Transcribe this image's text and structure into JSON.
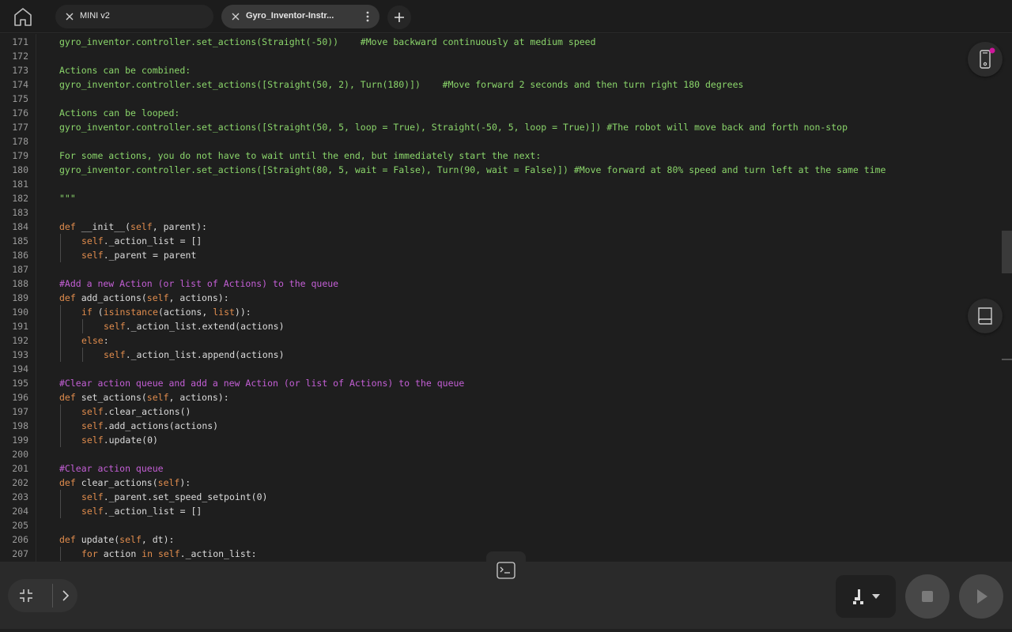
{
  "tabs": [
    {
      "label": "MINI v2",
      "active": false
    },
    {
      "label": "Gyro_Inventor-Instr...",
      "active": true
    }
  ],
  "icons": {
    "home": "home-icon",
    "close": "close-icon",
    "menu": "more-vertical-icon",
    "add": "plus-icon",
    "device": "robot-device-icon",
    "docs": "book-icon",
    "terminal": "terminal-icon",
    "collapse": "collapse-icon",
    "expand": "chevron-right-icon",
    "robot": "robot-select-icon",
    "dropdown": "caret-down-icon",
    "stop": "stop-icon",
    "run": "play-icon"
  },
  "colors": {
    "docstring": "#8bd66b",
    "comment": "#c45fd6",
    "keyword": "#e08c4d",
    "text": "#dcdcdc",
    "badge": "#d0169c"
  },
  "code_lines": [
    {
      "n": "171",
      "indent": 0,
      "parts": [
        [
          "doc",
          "gyro_inventor.controller.set_actions(Straight(-50))    #Move backward continuously at medium speed"
        ]
      ]
    },
    {
      "n": "172",
      "indent": 0,
      "parts": []
    },
    {
      "n": "173",
      "indent": 0,
      "parts": [
        [
          "doc",
          "Actions can be combined:"
        ]
      ]
    },
    {
      "n": "174",
      "indent": 0,
      "parts": [
        [
          "doc",
          "gyro_inventor.controller.set_actions([Straight(50, 2), Turn(180)])    #Move forward 2 seconds and then turn right 180 degrees"
        ]
      ]
    },
    {
      "n": "175",
      "indent": 0,
      "parts": []
    },
    {
      "n": "176",
      "indent": 0,
      "parts": [
        [
          "doc",
          "Actions can be looped:"
        ]
      ]
    },
    {
      "n": "177",
      "indent": 0,
      "parts": [
        [
          "doc",
          "gyro_inventor.controller.set_actions([Straight(50, 5, loop = True), Straight(-50, 5, loop = True)]) #The robot will move back and forth non-stop"
        ]
      ]
    },
    {
      "n": "178",
      "indent": 0,
      "parts": []
    },
    {
      "n": "179",
      "indent": 0,
      "parts": [
        [
          "doc",
          "For some actions, you do not have to wait until the end, but immediately start the next:"
        ]
      ]
    },
    {
      "n": "180",
      "indent": 0,
      "parts": [
        [
          "doc",
          "gyro_inventor.controller.set_actions([Straight(80, 5, wait = False), Turn(90, wait = False)]) #Move forward at 80% speed and turn left at the same time"
        ]
      ]
    },
    {
      "n": "181",
      "indent": 0,
      "parts": []
    },
    {
      "n": "182",
      "indent": 0,
      "parts": [
        [
          "doc",
          "\"\"\""
        ]
      ]
    },
    {
      "n": "183",
      "indent": 0,
      "parts": []
    },
    {
      "n": "184",
      "indent": 0,
      "parts": [
        [
          "kw",
          "def "
        ],
        [
          "txt",
          "__init__("
        ],
        [
          "self",
          "self"
        ],
        [
          "txt",
          ", parent):"
        ]
      ]
    },
    {
      "n": "185",
      "indent": 1,
      "parts": [
        [
          "self",
          "self"
        ],
        [
          "txt",
          "._action_list = []"
        ]
      ]
    },
    {
      "n": "186",
      "indent": 1,
      "parts": [
        [
          "self",
          "self"
        ],
        [
          "txt",
          "._parent = parent"
        ]
      ]
    },
    {
      "n": "187",
      "indent": 0,
      "parts": []
    },
    {
      "n": "188",
      "indent": 0,
      "parts": [
        [
          "com",
          "#Add a new Action (or list of Actions) to the queue"
        ]
      ]
    },
    {
      "n": "189",
      "indent": 0,
      "parts": [
        [
          "kw",
          "def "
        ],
        [
          "txt",
          "add_actions("
        ],
        [
          "self",
          "self"
        ],
        [
          "txt",
          ", actions):"
        ]
      ]
    },
    {
      "n": "190",
      "indent": 1,
      "parts": [
        [
          "kw",
          "if "
        ],
        [
          "txt",
          "("
        ],
        [
          "bi",
          "isinstance"
        ],
        [
          "txt",
          "(actions, "
        ],
        [
          "bi",
          "list"
        ],
        [
          "txt",
          ")):"
        ]
      ]
    },
    {
      "n": "191",
      "indent": 2,
      "parts": [
        [
          "self",
          "self"
        ],
        [
          "txt",
          "._action_list.extend(actions)"
        ]
      ]
    },
    {
      "n": "192",
      "indent": 1,
      "parts": [
        [
          "kw",
          "else"
        ],
        [
          "txt",
          ":"
        ]
      ]
    },
    {
      "n": "193",
      "indent": 2,
      "parts": [
        [
          "self",
          "self"
        ],
        [
          "txt",
          "._action_list.append(actions)"
        ]
      ]
    },
    {
      "n": "194",
      "indent": 0,
      "parts": []
    },
    {
      "n": "195",
      "indent": 0,
      "parts": [
        [
          "com",
          "#Clear action queue and add a new Action (or list of Actions) to the queue"
        ]
      ]
    },
    {
      "n": "196",
      "indent": 0,
      "parts": [
        [
          "kw",
          "def "
        ],
        [
          "txt",
          "set_actions("
        ],
        [
          "self",
          "self"
        ],
        [
          "txt",
          ", actions):"
        ]
      ]
    },
    {
      "n": "197",
      "indent": 1,
      "parts": [
        [
          "self",
          "self"
        ],
        [
          "txt",
          ".clear_actions()"
        ]
      ]
    },
    {
      "n": "198",
      "indent": 1,
      "parts": [
        [
          "self",
          "self"
        ],
        [
          "txt",
          ".add_actions(actions)"
        ]
      ]
    },
    {
      "n": "199",
      "indent": 1,
      "parts": [
        [
          "self",
          "self"
        ],
        [
          "txt",
          ".update(0)"
        ]
      ]
    },
    {
      "n": "200",
      "indent": 0,
      "parts": []
    },
    {
      "n": "201",
      "indent": 0,
      "parts": [
        [
          "com",
          "#Clear action queue"
        ]
      ]
    },
    {
      "n": "202",
      "indent": 0,
      "parts": [
        [
          "kw",
          "def "
        ],
        [
          "txt",
          "clear_actions("
        ],
        [
          "self",
          "self"
        ],
        [
          "txt",
          "):"
        ]
      ]
    },
    {
      "n": "203",
      "indent": 1,
      "parts": [
        [
          "self",
          "self"
        ],
        [
          "txt",
          "._parent.set_speed_setpoint(0)"
        ]
      ]
    },
    {
      "n": "204",
      "indent": 1,
      "parts": [
        [
          "self",
          "self"
        ],
        [
          "txt",
          "._action_list = []"
        ]
      ]
    },
    {
      "n": "205",
      "indent": 0,
      "parts": []
    },
    {
      "n": "206",
      "indent": 0,
      "parts": [
        [
          "kw",
          "def "
        ],
        [
          "txt",
          "update("
        ],
        [
          "self",
          "self"
        ],
        [
          "txt",
          ", dt):"
        ]
      ]
    },
    {
      "n": "207",
      "indent": 1,
      "parts": [
        [
          "kw",
          "for "
        ],
        [
          "txt",
          "action "
        ],
        [
          "kw",
          "in "
        ],
        [
          "self",
          "self"
        ],
        [
          "txt",
          "._action_list:"
        ]
      ]
    }
  ]
}
